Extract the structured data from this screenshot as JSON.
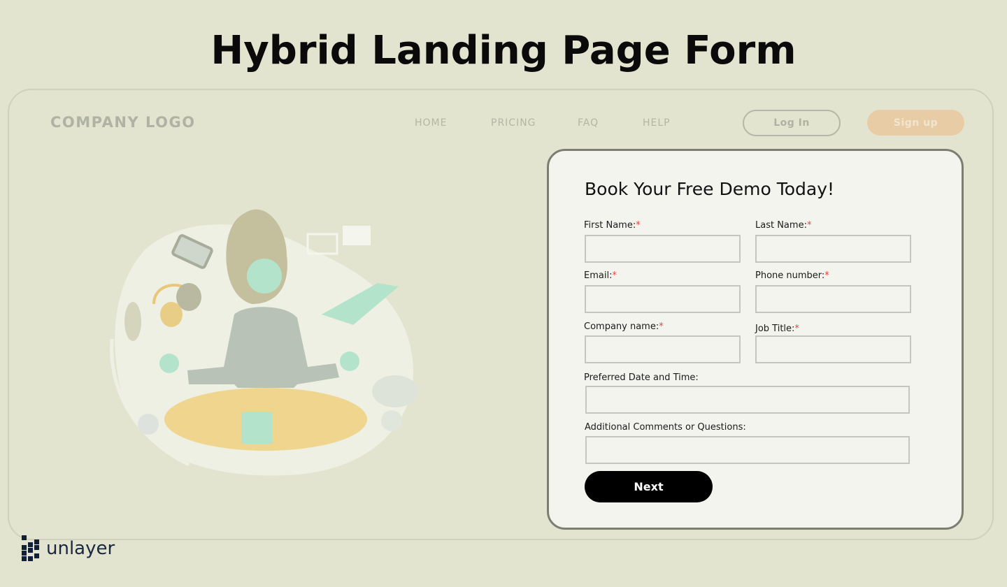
{
  "page": {
    "title": "Hybrid Landing Page Form"
  },
  "header": {
    "logo": "COMPANY LOGO",
    "nav": [
      "HOME",
      "PRICING",
      "FAQ",
      "HELP"
    ],
    "login_label": "Log In",
    "signup_label": "Sign up"
  },
  "illustration": {
    "icon": "meditating-person-illustration"
  },
  "form": {
    "title": "Book Your Free Demo Today!",
    "required_marker": "*",
    "fields": [
      {
        "label": "First Name:",
        "required": true,
        "value": "",
        "placeholder": ""
      },
      {
        "label": "Last Name:",
        "required": true,
        "value": "",
        "placeholder": ""
      },
      {
        "label": "Email:",
        "required": true,
        "value": "",
        "placeholder": ""
      },
      {
        "label": "Phone number:",
        "required": true,
        "value": "",
        "placeholder": ""
      },
      {
        "label": "Company name:",
        "required": true,
        "value": "",
        "placeholder": ""
      },
      {
        "label": "Job Title:",
        "required": true,
        "value": "",
        "placeholder": ""
      },
      {
        "label": "Preferred Date and Time:",
        "required": false,
        "value": "",
        "placeholder": ""
      },
      {
        "label": "Additional Comments or Questions:",
        "required": false,
        "value": "",
        "placeholder": ""
      }
    ],
    "next_label": "Next"
  },
  "brand": {
    "name": "unlayer",
    "icon": "unlayer-logo-icon"
  },
  "colors": {
    "background": "#e3e4cf",
    "card": "#f4f4ef",
    "signup": "#e8cca6",
    "required": "#e0453d",
    "button": "#000000"
  }
}
